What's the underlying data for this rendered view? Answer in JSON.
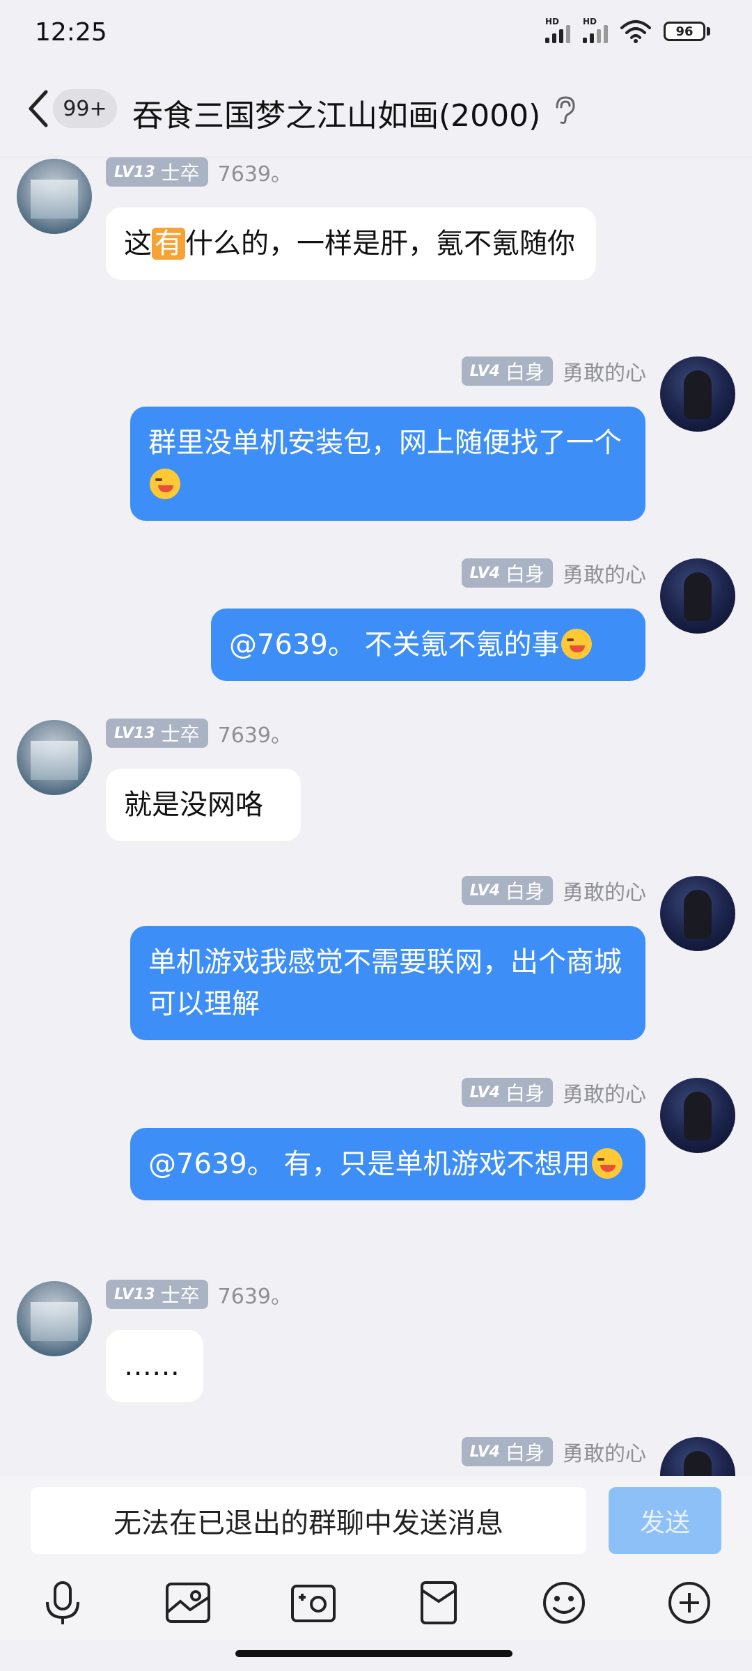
{
  "status_bar": {
    "time": "12:25",
    "battery": "96",
    "hd_label": "HD"
  },
  "header": {
    "back_label": "返回",
    "unread_badge": "99+",
    "title": "吞食三国梦之江山如画(2000)"
  },
  "messages": [
    {
      "side": "in",
      "level": "LV13",
      "rank": "士卒",
      "nickname": "7639。",
      "text_before": "这",
      "highlight": "有",
      "text_after": "什么的，一样是肝，氪不氪随你"
    },
    {
      "side": "out",
      "level": "LV4",
      "rank": "白身",
      "nickname": "勇敢的心",
      "text": "群里没单机安装包，网上随便找了一个"
    },
    {
      "side": "out",
      "level": "LV4",
      "rank": "白身",
      "nickname": "勇敢的心",
      "text": "@7639。 不关氪不氪的事"
    },
    {
      "side": "in",
      "level": "LV13",
      "rank": "士卒",
      "nickname": "7639。",
      "text": "就是没网咯"
    },
    {
      "side": "out",
      "level": "LV4",
      "rank": "白身",
      "nickname": "勇敢的心",
      "text": "单机游戏我感觉不需要联网，出个商城可以理解"
    },
    {
      "side": "out",
      "level": "LV4",
      "rank": "白身",
      "nickname": "勇敢的心",
      "text": "@7639。 有，只是单机游戏不想用"
    },
    {
      "side": "in",
      "level": "LV13",
      "rank": "士卒",
      "nickname": "7639。",
      "text": "……"
    },
    {
      "side": "out",
      "level": "LV4",
      "rank": "白身",
      "nickname": "勇敢的心"
    }
  ],
  "input": {
    "disabled_text": "无法在已退出的群聊中发送消息",
    "send_label": "发送"
  },
  "toolbar": {
    "icons": [
      "microphone-icon",
      "image-icon",
      "camera-icon",
      "red-packet-icon",
      "emoji-icon",
      "plus-icon"
    ]
  },
  "colors": {
    "out_bubble": "#3d8ef6",
    "in_bubble": "#ffffff",
    "background": "#f1f1f5",
    "level_tag": "#aab3c3"
  }
}
